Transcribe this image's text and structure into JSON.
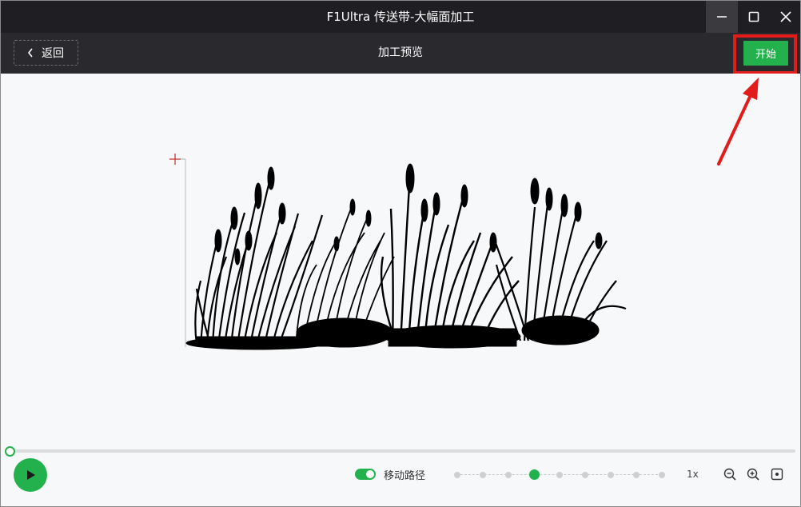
{
  "window": {
    "title": "F1Ultra 传送带-大幅面加工"
  },
  "toolbar": {
    "back_label": "返回",
    "page_title": "加工预览",
    "start_label": "开始"
  },
  "controls": {
    "move_path_label": "移动路径",
    "move_path_enabled": true,
    "speed_label": "1x",
    "speed_steps": 9,
    "speed_selected_index": 3,
    "progress": 0
  },
  "colors": {
    "accent": "#22b14c",
    "annotation": "#e21b1b",
    "titlebar": "#1f1f23",
    "toolbar": "#2a2a2e"
  },
  "icons": {
    "back": "chevron-left-icon",
    "minimize": "minimize-icon",
    "maximize": "maximize-icon",
    "close": "close-icon",
    "play": "play-icon",
    "zoom_out": "zoom-out-icon",
    "zoom_in": "zoom-in-icon",
    "fit": "fit-view-icon"
  }
}
